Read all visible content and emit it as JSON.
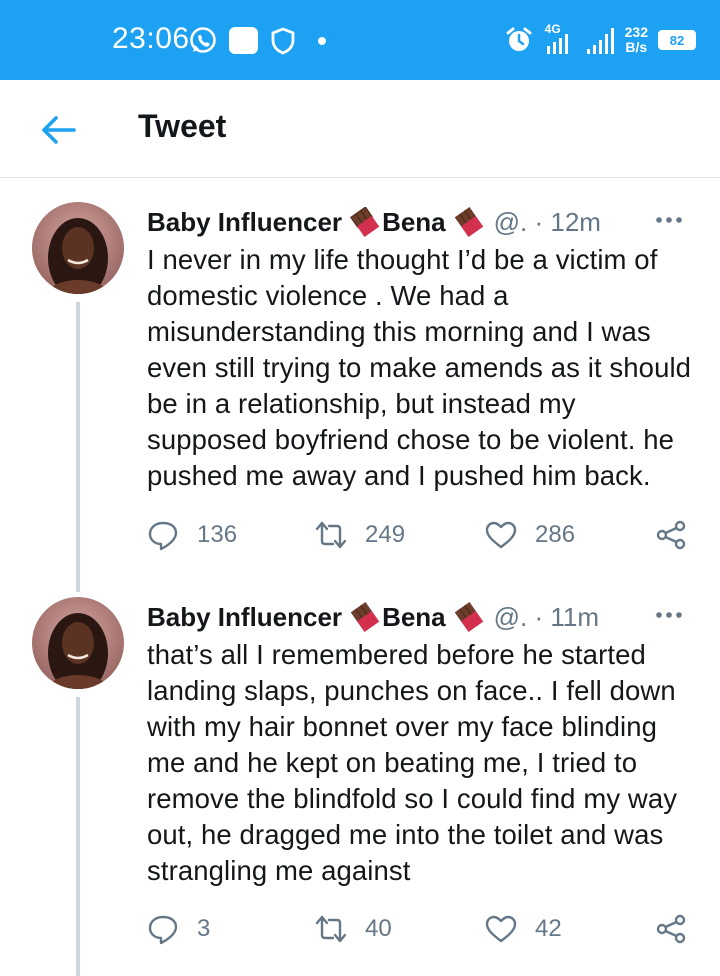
{
  "status_bar": {
    "time": "23:06",
    "network": "4G",
    "speed_value": "232",
    "speed_unit": "B/s",
    "battery": "82",
    "icons": [
      "whatsapp-icon",
      "app-icon",
      "shield-icon",
      "dot-icon",
      "alarm-icon",
      "signal-icon",
      "signal-icon",
      "battery-icon"
    ]
  },
  "header": {
    "title": "Tweet",
    "back_icon": "arrow-left-icon"
  },
  "colors": {
    "brand": "#1da1f2",
    "text": "#14171a",
    "muted": "#657786",
    "divider": "#ccd6dd"
  },
  "tweets": [
    {
      "name_part1": "Baby Influencer",
      "name_part2": "Bena",
      "handle": "@. · 12m",
      "text": "I never in my life thought I’d be a victim of domestic violence . We had a misunderstanding this morning and I was even still trying to make amends as it should be in a relationship, but instead my supposed boyfriend chose to be violent. he pushed me away and I pushed him back.",
      "replies": "136",
      "retweets": "249",
      "likes": "286"
    },
    {
      "name_part1": "Baby Influencer",
      "name_part2": "Bena",
      "handle": "@. · 11m",
      "text": "that’s all I remembered before he started landing slaps, punches on face.. I fell down with my hair bonnet over my face blinding me and he kept on beating me, I tried to remove the blindfold so I could find my way out, he dragged me into the toilet and was strangling me against",
      "replies": "3",
      "retweets": "40",
      "likes": "42"
    }
  ]
}
